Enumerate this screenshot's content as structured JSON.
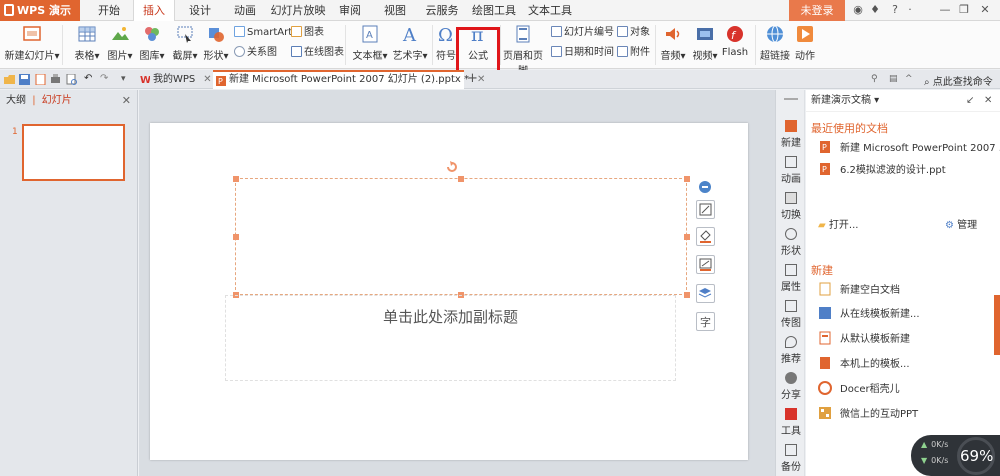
{
  "app": {
    "name": "WPS 演示"
  },
  "menu": {
    "tabs": [
      "开始",
      "插入",
      "设计",
      "动画",
      "幻灯片放映",
      "审阅",
      "视图",
      "云服务",
      "绘图工具",
      "文本工具"
    ],
    "active": "插入",
    "login": "未登录"
  },
  "ribbon": {
    "new_slide": "新建幻灯片",
    "table": "表格",
    "picture": "图片",
    "gallery": "图库",
    "screenshot": "截屏",
    "shape": "形状",
    "smartart": "SmartArt",
    "chart": "图表",
    "relation": "关系图",
    "online_chart": "在线图表",
    "textbox": "文本框",
    "art_text": "艺术字",
    "symbol": "符号",
    "formula": "公式",
    "header_footer": "页眉和页脚",
    "slide_number": "幻灯片编号",
    "object": "对象",
    "datetime": "日期和时间",
    "attachment": "附件",
    "audio": "音频",
    "video": "视频",
    "flash": "Flash",
    "hyperlink": "超链接",
    "action": "动作"
  },
  "doc_tabs": {
    "my_wps": "我的WPS",
    "active_doc": "新建 Microsoft PowerPoint 2007 幻灯片 (2).pptx *",
    "find_command": "点此查找命令"
  },
  "left_panel": {
    "outline": "大纲",
    "slides": "幻灯片",
    "slide_number": "1"
  },
  "slide": {
    "subtitle_placeholder": "单击此处添加副标题"
  },
  "side_bar": [
    "新建",
    "动画",
    "切换",
    "形状",
    "属性",
    "传图",
    "推荐",
    "分享",
    "工具",
    "备份"
  ],
  "task_pane": {
    "title": "新建演示文稿",
    "recent_heading": "最近使用的文档",
    "recent": [
      "新建 Microsoft PowerPoint 2007 ...",
      "6.2模拟滤波的设计.ppt"
    ],
    "open": "打开...",
    "manage": "管理",
    "new_heading": "新建",
    "new_items": [
      "新建空白文档",
      "从在线模板新建...",
      "从默认模板新建",
      "本机上的模板...",
      "Docer稻壳儿",
      "微信上的互动PPT"
    ]
  },
  "net_widget": {
    "up": "0K/s",
    "down": "0K/s",
    "percent": "69%"
  },
  "colors": {
    "accent": "#e0652f",
    "highlight": "#e0161a",
    "active_tab_text": "#c8371a"
  }
}
